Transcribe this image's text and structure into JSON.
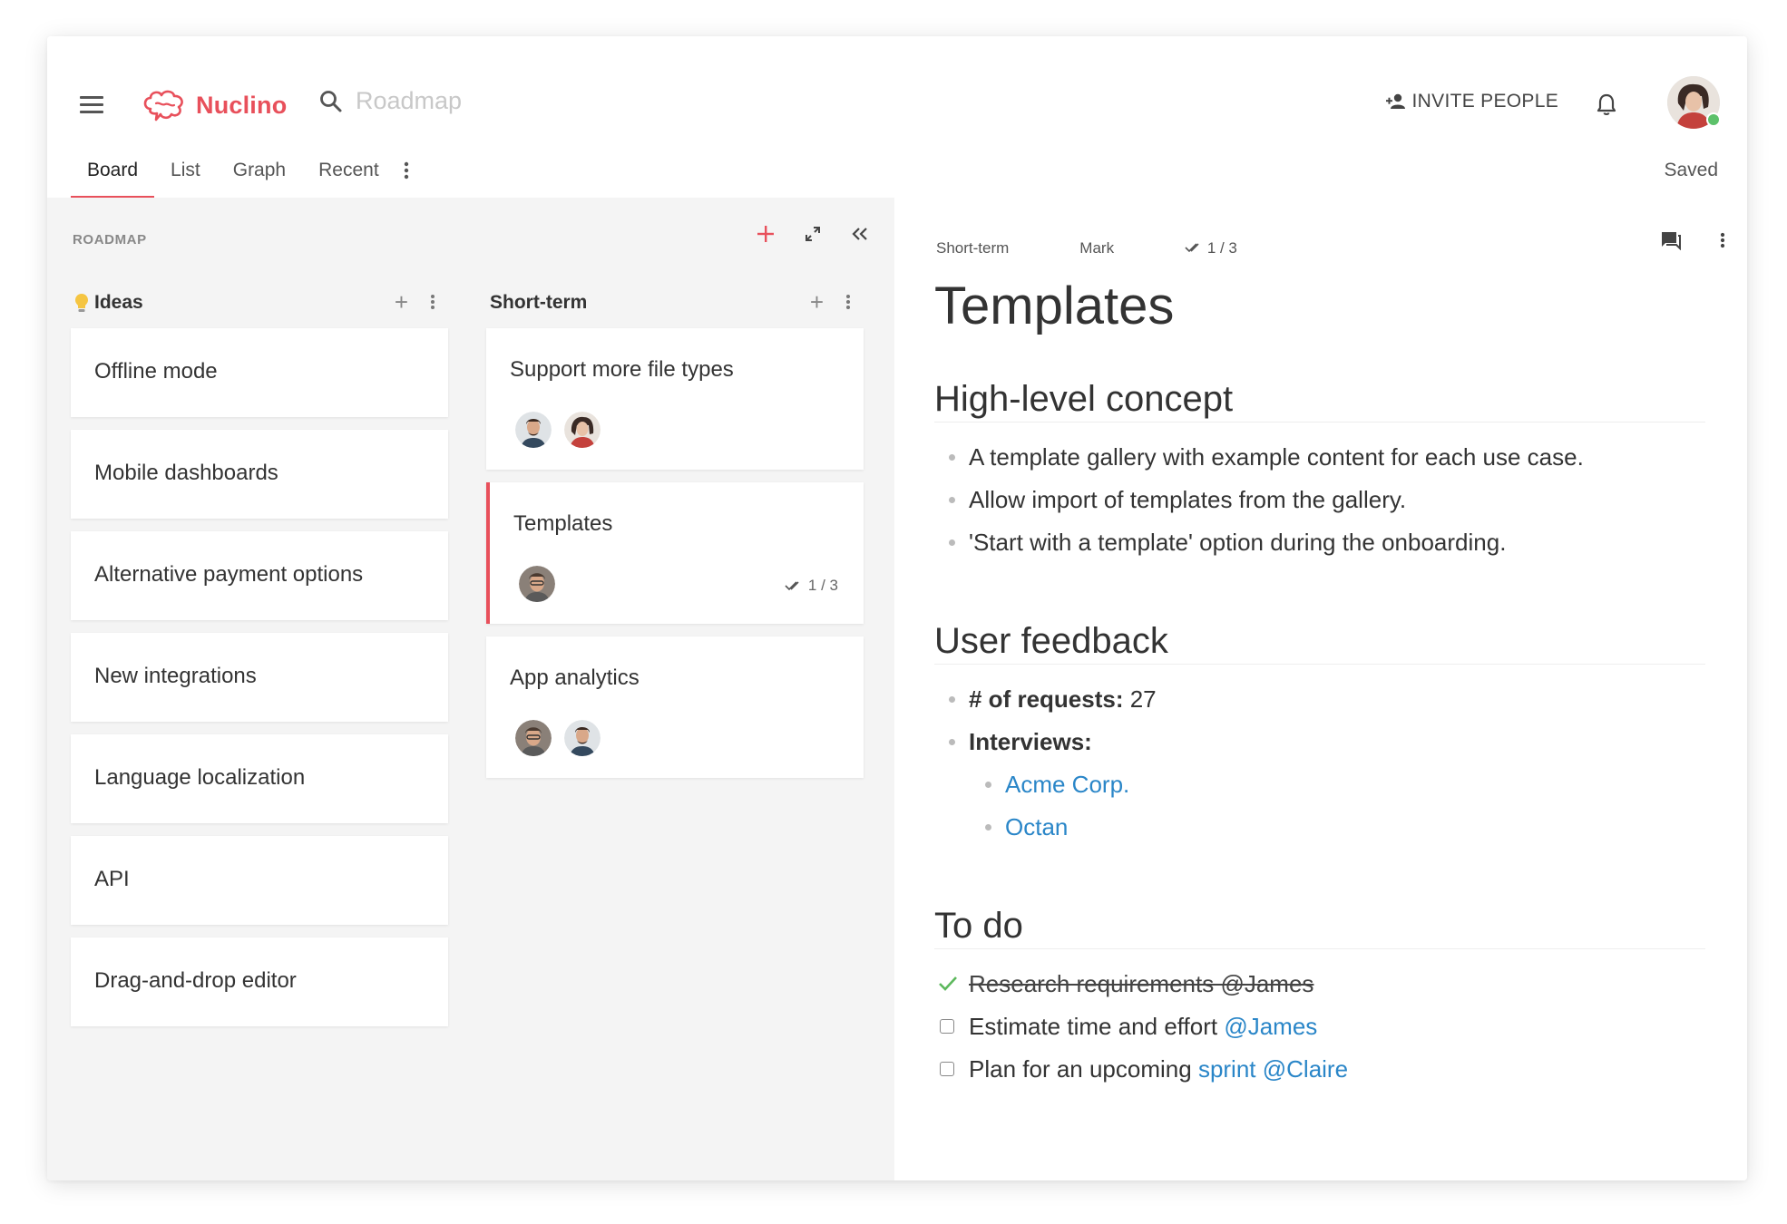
{
  "app": {
    "name": "Nuclino",
    "brand_color": "#e8505b"
  },
  "search": {
    "placeholder": "Roadmap"
  },
  "header": {
    "invite_label": "INVITE PEOPLE",
    "saved_label": "Saved"
  },
  "tabs": [
    {
      "label": "Board",
      "active": true
    },
    {
      "label": "List"
    },
    {
      "label": "Graph"
    },
    {
      "label": "Recent"
    }
  ],
  "board": {
    "label": "ROADMAP",
    "columns": [
      {
        "title": "Ideas",
        "icon": "lightbulb-icon",
        "cards": [
          {
            "title": "Offline mode"
          },
          {
            "title": "Mobile dashboards"
          },
          {
            "title": "Alternative payment options"
          },
          {
            "title": "New integrations"
          },
          {
            "title": "Language localization"
          },
          {
            "title": "API"
          },
          {
            "title": "Drag-and-drop editor"
          }
        ]
      },
      {
        "title": "Short-term",
        "cards": [
          {
            "title": "Support more file types"
          },
          {
            "title": "Templates",
            "selected": true,
            "checklist": "1 / 3"
          },
          {
            "title": "App analytics"
          }
        ]
      }
    ]
  },
  "document": {
    "meta": {
      "column": "Short-term",
      "assignee": "Mark",
      "checklist": "1 / 3"
    },
    "title": "Templates",
    "sections": {
      "concept": {
        "heading": "High-level concept",
        "items": [
          "A template gallery with example content for each use case.",
          "Allow import of templates from the gallery.",
          "'Start with a template' option during the onboarding."
        ]
      },
      "feedback": {
        "heading": "User feedback",
        "requests_label": "# of requests:",
        "requests_value": " 27",
        "interviews_label": "Interviews:",
        "interviews": [
          "Acme Corp.",
          "Octan"
        ]
      },
      "todo": {
        "heading": "To do",
        "items": [
          {
            "text": "Research requirements @James",
            "done": true
          },
          {
            "text": "Estimate time and effort ",
            "mention": "@James",
            "done": false
          },
          {
            "text": "Plan for an upcoming ",
            "link": "sprint",
            "mention": "@Claire",
            "done": false
          }
        ]
      }
    }
  }
}
